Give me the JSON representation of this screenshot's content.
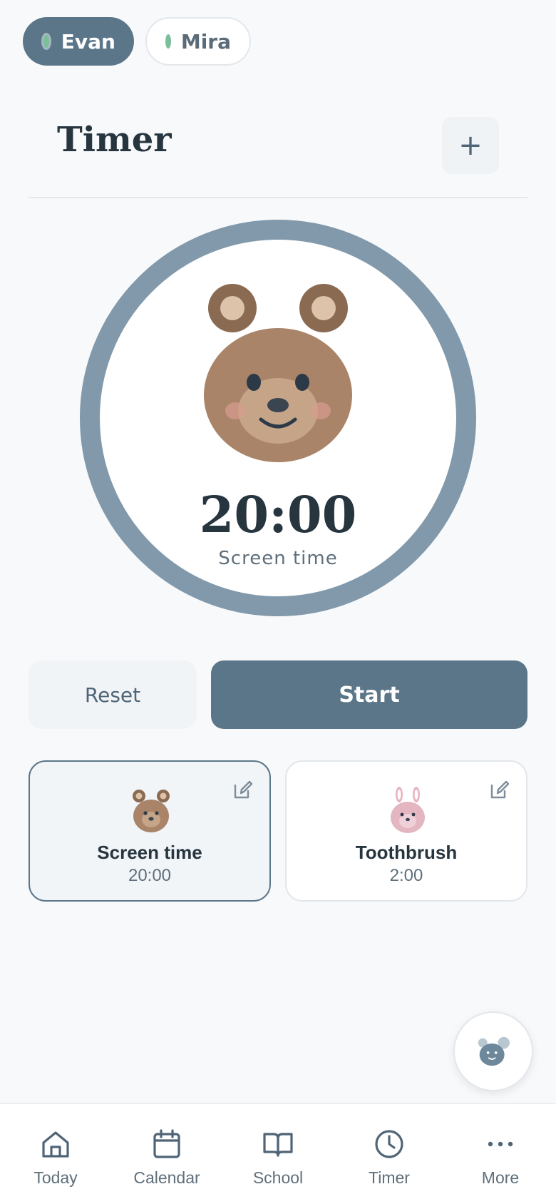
{
  "profiles": [
    {
      "name": "Evan",
      "active": true
    },
    {
      "name": "Mira",
      "active": false
    }
  ],
  "header": {
    "title": "Timer",
    "add_label": "+"
  },
  "timer": {
    "display": "20:00",
    "label": "Screen time"
  },
  "controls": {
    "reset_label": "Reset",
    "start_label": "Start"
  },
  "cards": [
    {
      "name": "Screen time",
      "duration": "20:00",
      "icon": "bear-icon",
      "selected": true
    },
    {
      "name": "Toothbrush",
      "duration": "2:00",
      "icon": "bunny-icon",
      "selected": false
    }
  ],
  "nav": {
    "items": [
      {
        "label": "Today",
        "icon": "home-icon"
      },
      {
        "label": "Calendar",
        "icon": "calendar-icon"
      },
      {
        "label": "School",
        "icon": "book-icon"
      },
      {
        "label": "Timer",
        "icon": "clock-icon"
      },
      {
        "label": "More",
        "icon": "more-icon"
      }
    ]
  },
  "colors": {
    "accent": "#5b7689",
    "ring": "#8199ab",
    "status_dot": "#7bbf9a",
    "text_dark": "#27353f",
    "background": "#f8f9fb"
  }
}
